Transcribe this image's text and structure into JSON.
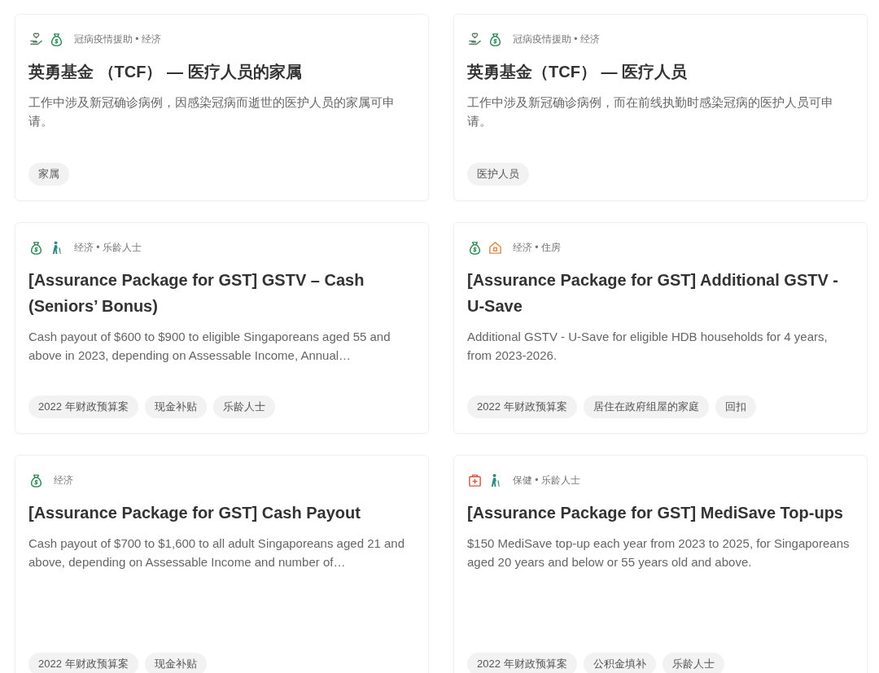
{
  "cards": [
    {
      "icons": [
        {
          "kind": "care"
        },
        {
          "kind": "money"
        }
      ],
      "category": "冠病疫情援助 • 经济",
      "title": "英勇基金 （TCF） — 医疗人员的家属",
      "description": "工作中涉及新冠确诊病例，因感染冠病而逝世的医护人员的家属可申请。",
      "tags": [
        "家属"
      ]
    },
    {
      "icons": [
        {
          "kind": "care"
        },
        {
          "kind": "money"
        }
      ],
      "category": "冠病疫情援助 • 经济",
      "title": "英勇基金（TCF） — 医疗人员",
      "description": "工作中涉及新冠确诊病例，而在前线执勤时感染冠病的医护人员可申请。",
      "tags": [
        "医护人员"
      ]
    },
    {
      "icons": [
        {
          "kind": "money"
        },
        {
          "kind": "senior"
        }
      ],
      "category": "经济 • 乐龄人士",
      "title": "[Assurance Package for GST] GSTV – Cash (Seniors’ Bonus)",
      "description": "Cash payout of $600 to $900 to eligible Singaporeans aged 55 and above in 2023, depending on Assessable Income, Annual…",
      "tags": [
        "2022 年财政预算案",
        "现金补贴",
        "乐龄人士"
      ]
    },
    {
      "icons": [
        {
          "kind": "money"
        },
        {
          "kind": "house"
        }
      ],
      "category": "经济 • 住房",
      "title": "[Assurance Package for GST] Additional GSTV - U-Save",
      "description": "Additional GSTV - U-Save for eligible HDB households for 4 years, from 2023-2026.",
      "tags": [
        "2022 年财政预算案",
        "居住在政府组屋的家庭",
        "回扣"
      ]
    },
    {
      "icons": [
        {
          "kind": "money"
        }
      ],
      "category": "经济",
      "title": "[Assurance Package for GST] Cash Payout",
      "description": "Cash payout of $700 to $1,600 to all adult Singaporeans aged 21 and above, depending on Assessable Income and number of…",
      "tags": [
        "2022 年财政预算案",
        "现金补贴"
      ]
    },
    {
      "icons": [
        {
          "kind": "medical"
        },
        {
          "kind": "senior"
        }
      ],
      "category": "保健 • 乐龄人士",
      "title": "[Assurance Package for GST] MediSave Top-ups",
      "description": "$150 MediSave top-up each year from 2023 to 2025, for Singaporeans aged 20 years and below or 55 years old and above.",
      "tags": [
        "2022 年财政预算案",
        "公积金填补",
        "乐龄人士"
      ]
    }
  ]
}
